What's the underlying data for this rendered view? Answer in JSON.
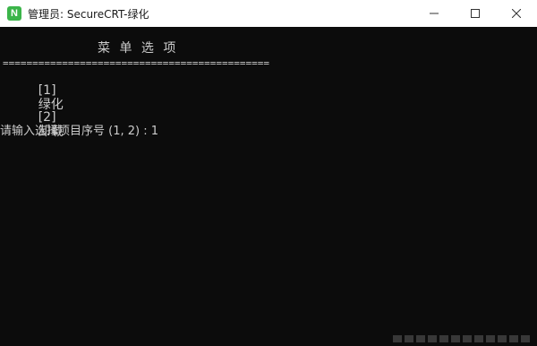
{
  "window": {
    "title": "管理员:  SecureCRT-绿化",
    "app_icon_letter": "N",
    "controls": [
      "minimize-icon",
      "maximize-icon",
      "close-icon"
    ]
  },
  "terminal": {
    "menu_title": "菜 单 选 项",
    "separator": "=============================================",
    "options": [
      {
        "key": "[1]",
        "label": "绿化"
      },
      {
        "key": "[2]",
        "label": "卸载"
      }
    ],
    "prompt": "请输入选择项目序号 (1, 2) : 1"
  },
  "colors": {
    "terminal_bg": "#0c0c0c",
    "terminal_fg": "#cccccc",
    "titlebar_bg": "#ffffff",
    "app_icon_bg": "#3bb54a"
  }
}
